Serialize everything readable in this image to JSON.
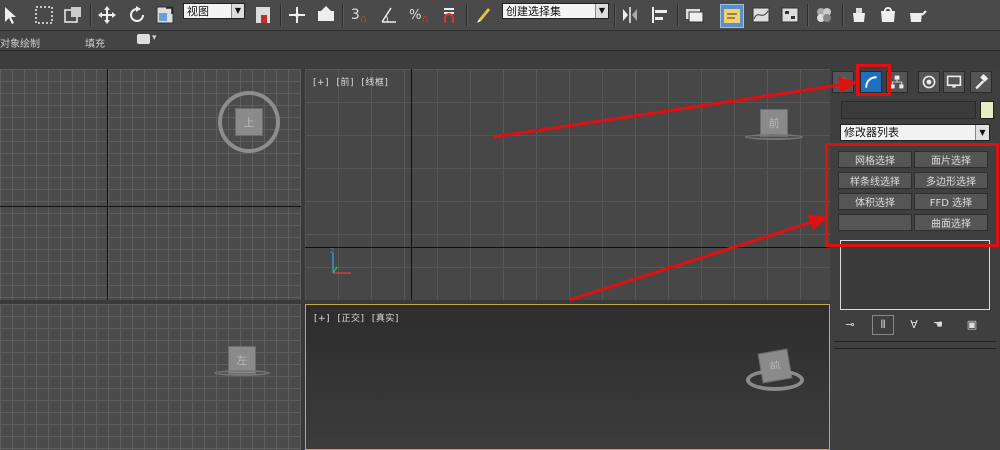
{
  "toolbar": {
    "view_select": "视图",
    "selection_set": "创建选择集",
    "snap_3": "3",
    "icons": [
      "select-arrow-icon",
      "rect-select-icon",
      "window-crossing-icon",
      "move-icon",
      "rotate-icon",
      "scale-icon",
      "pivot-icon",
      "select-manipulate-icon",
      "keyboard-shortcut-icon",
      "snap-3d-icon",
      "angle-snap-icon",
      "percent-snap-icon",
      "spinner-snap-icon",
      "edit-named-selection-icon",
      "mirror-icon",
      "align-icon",
      "layer-manager-icon",
      "scene-explorer-icon",
      "curve-editor-icon",
      "schematic-view-icon",
      "material-editor-icon",
      "render-setup-icon",
      "render-frame-icon",
      "render-icon"
    ]
  },
  "ribbon": {
    "object_paint": "对象绘制",
    "fill": "填充"
  },
  "viewports": {
    "top": {
      "cube_label": "上"
    },
    "front": {
      "label_plus": "[+]",
      "label_view": "[前]",
      "label_shading": "[线框]",
      "cube_label": "前"
    },
    "left": {
      "cube_label": "左"
    },
    "perspective": {
      "label_plus": "[+]",
      "label_view": "[正交]",
      "label_shading": "[真实]",
      "cube_label": "前"
    }
  },
  "command_panel": {
    "tabs": [
      "create-tab",
      "modify-tab",
      "hierarchy-tab",
      "motion-tab",
      "display-tab",
      "utilities-tab"
    ],
    "active_tab": "modify-tab",
    "modifier_list": "修改器列表",
    "modifier_buttons": [
      [
        "网格选择",
        "面片选择"
      ],
      [
        "样条线选择",
        "多边形选择"
      ],
      [
        "体积选择",
        "FFD 选择"
      ],
      [
        "",
        "曲面选择"
      ]
    ]
  },
  "colors": {
    "highlight": "#e11010",
    "active_tab": "#1d6fbf",
    "active_viewport_border": "#c8a74a"
  }
}
